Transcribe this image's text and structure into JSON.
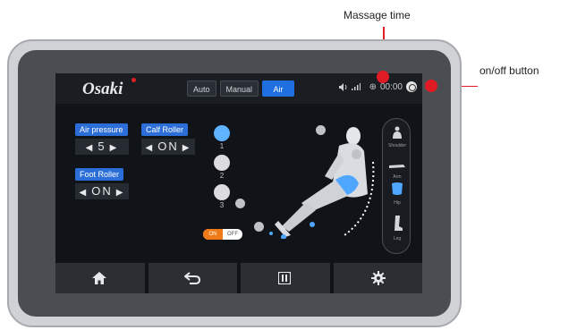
{
  "callouts": {
    "massage_time": "Massage time",
    "onoff": "on/off button"
  },
  "brand": "Osaki",
  "mode_tabs": [
    "Auto",
    "Manual",
    "Air"
  ],
  "active_mode": "Air",
  "status": {
    "timer": "00:00"
  },
  "controls": {
    "air_pressure": {
      "label": "Air pressure",
      "value": "5"
    },
    "calf_roller": {
      "label": "Calf Roller",
      "value": "ON"
    },
    "foot_roller": {
      "label": "Foot Roller",
      "value": "ON"
    }
  },
  "steps": [
    "1",
    "2",
    "3"
  ],
  "toggle": {
    "on": "ON",
    "off": "OFF"
  },
  "body_parts": [
    "Shoulder",
    "Arm",
    "Hip",
    "Leg"
  ],
  "colors": {
    "accent": "#1f6fe0",
    "callout": "#e01b24",
    "toggle_on": "#f07b16"
  },
  "icons": {
    "bottom_nav": [
      "home-icon",
      "back-icon",
      "pause-icon",
      "settings-icon"
    ]
  }
}
